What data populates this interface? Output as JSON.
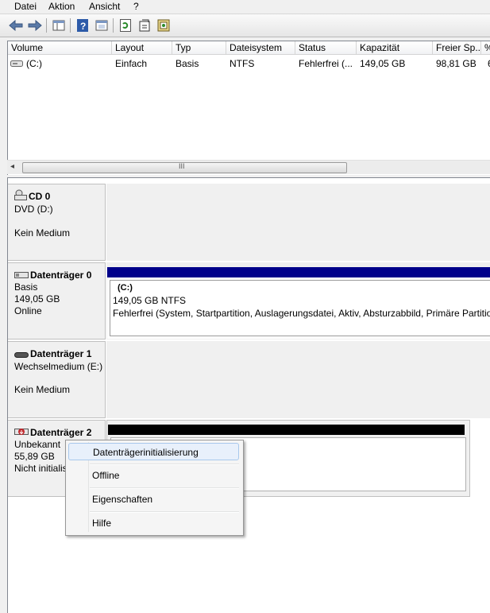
{
  "menu": [
    "Datei",
    "Aktion",
    "Ansicht",
    "?"
  ],
  "toolbar": {
    "buttons": [
      "back-icon",
      "forward-icon",
      "console-tree-icon",
      "help-icon",
      "properties-icon",
      "refresh-icon",
      "action-properties-icon",
      "rescan-icon"
    ]
  },
  "volume_table": {
    "columns": [
      "Volume",
      "Layout",
      "Typ",
      "Dateisystem",
      "Status",
      "Kapazität",
      "Freier Sp...",
      "%"
    ],
    "rows": [
      {
        "volume": "(C:)",
        "layout": "Einfach",
        "typ": "Basis",
        "dateisystem": "NTFS",
        "status": "Fehlerfrei (...",
        "kapazitaet": "149,05 GB",
        "frei": "98,81 GB",
        "prozent": "6"
      }
    ]
  },
  "scrollbar": {
    "grip": "III"
  },
  "disks": [
    {
      "name": "CD 0",
      "line2": "DVD (D:)",
      "line3": "",
      "line4": "Kein Medium"
    },
    {
      "name": "Datenträger 0",
      "line2": "Basis",
      "line3": "149,05 GB",
      "line4": "Online",
      "partition": {
        "name": "(C:)",
        "size": "149,05 GB NTFS",
        "status": "Fehlerfrei (System, Startpartition, Auslagerungsdatei, Aktiv, Absturzabbild, Primäre Partition)"
      }
    },
    {
      "name": "Datenträger 1",
      "line2": "Wechselmedium (E:)",
      "line3": "",
      "line4": "Kein Medium"
    },
    {
      "name": "Datenträger 2",
      "line2": "Unbekannt",
      "line3": "55,89 GB",
      "line4": "Nicht initialisiert"
    }
  ],
  "context_menu": {
    "items": [
      "Datenträgerinitialisierung",
      "Offline",
      "Eigenschaften",
      "Hilfe"
    ]
  },
  "colors": {
    "primary_bar": "#00008b",
    "unallocated_bar": "#000000",
    "highlight": "#e8f0fb"
  }
}
